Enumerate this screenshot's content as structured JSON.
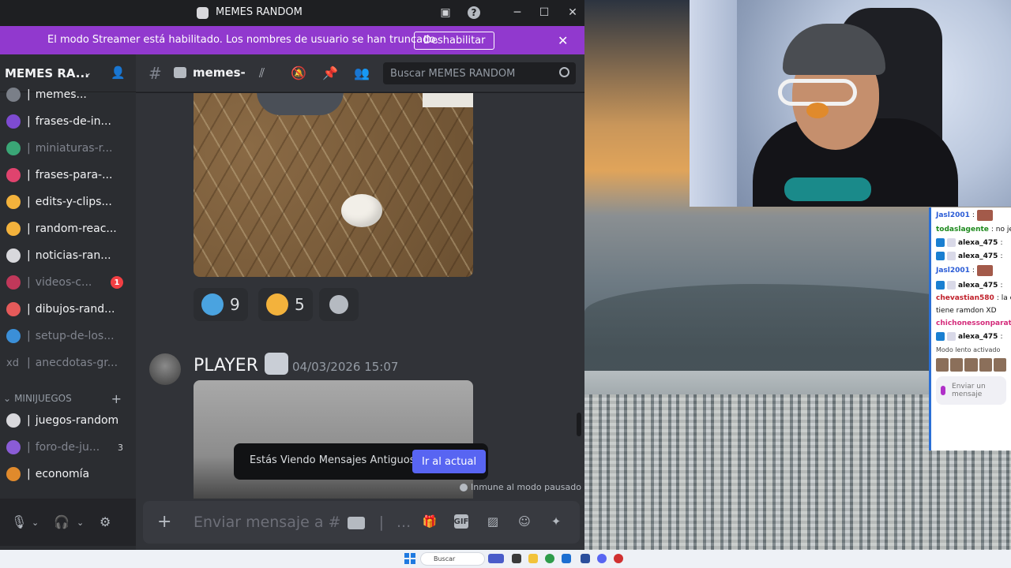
{
  "window": {
    "title": "MEMES RANDOM",
    "help_label": "?",
    "minimize_label": "─",
    "maximize_label": "☐",
    "close_label": "✕"
  },
  "streamer_banner": {
    "text": "El modo Streamer está habilitado. Los nombres de usuario se han truncado.",
    "button_label": "Deshabilitar",
    "close_label": "✕"
  },
  "server": {
    "name": "MEMES RA...",
    "chevron": "⌄"
  },
  "channels": [
    {
      "label": "memes...",
      "emoji_color": "#7a7f88",
      "muted": false,
      "extra": ""
    },
    {
      "label": "frases-de-in...",
      "emoji_color": "#7e4bd1",
      "muted": false,
      "extra": ""
    },
    {
      "label": "miniaturas-r...",
      "emoji_color": "#3aa676",
      "muted": true,
      "extra": ""
    },
    {
      "label": "frases-para-...",
      "emoji_color": "#e0436e",
      "muted": false,
      "extra": ""
    },
    {
      "label": "edits-y-clips...",
      "emoji_color": "#f3b23c",
      "muted": false,
      "extra": ""
    },
    {
      "label": "random-reac...",
      "emoji_color": "#f3b23c",
      "muted": false,
      "extra": ""
    },
    {
      "label": "noticias-ran...",
      "emoji_color": "#d8d8dc",
      "muted": false,
      "extra": ""
    },
    {
      "label": "videos-c...",
      "emoji_color": "#c0385a",
      "muted": true,
      "extra": "1"
    },
    {
      "label": "dibujos-rand...",
      "emoji_color": "#e55a5a",
      "muted": false,
      "extra": ""
    },
    {
      "label": "setup-de-los...",
      "emoji_color": "#3b8fd8",
      "muted": true,
      "extra": ""
    },
    {
      "label": "anecdotas-gr...",
      "emoji_color": "",
      "prefix": "xd",
      "muted": true,
      "extra": ""
    }
  ],
  "category": {
    "label": "MINIJUEGOS",
    "chevron": "⌄",
    "add": "+"
  },
  "channels2": [
    {
      "label": "juegos-random",
      "emoji_color": "#d8d8dc",
      "muted": false,
      "extra": ""
    },
    {
      "label": "foro-de-ju...",
      "emoji_color": "#8a5cd6",
      "muted": true,
      "extra": "3"
    },
    {
      "label": "economía",
      "emoji_color": "#e08a2c",
      "muted": false,
      "extra": ""
    }
  ],
  "user_panel": {
    "mic": "🎙",
    "headset": "🎧",
    "chev": "⌄",
    "settings": "⚙"
  },
  "channel_header": {
    "hash": "#",
    "name": "memes-",
    "search_placeholder": "Buscar MEMES RANDOM"
  },
  "reactions": [
    {
      "count": "9",
      "color": "#4aa3e0"
    },
    {
      "count": "5",
      "color": "#f3b23c"
    }
  ],
  "message": {
    "author": "PLAYER",
    "timestamp": "04/03/2026 15:07"
  },
  "old_messages": {
    "label": "Estás Viendo Mensajes Antiguos",
    "button": "Ir al actual"
  },
  "pause_note": "Inmune al modo pausado",
  "composer": {
    "plus": "+",
    "placeholder": "Enviar mensaje a #",
    "ellipsis": "...",
    "gif": "GIF"
  },
  "stream_chat": {
    "lines": [
      {
        "user": "Jasl2001",
        "color": "#2a5bd6",
        "msg": ":",
        "badges": false,
        "emote": true
      },
      {
        "user": "todaslagente",
        "color": "#1e8a1e",
        "msg": ": no je",
        "badges": false,
        "emote": false
      },
      {
        "user": "alexa_475",
        "color": "#111111",
        "msg": ":",
        "badges": true,
        "emote": false
      },
      {
        "user": "alexa_475",
        "color": "#111111",
        "msg": ":",
        "badges": true,
        "emote": false
      },
      {
        "user": "Jasl2001",
        "color": "#2a5bd6",
        "msg": ":",
        "badges": false,
        "emote": true
      },
      {
        "user": "alexa_475",
        "color": "#111111",
        "msg": ":",
        "badges": true,
        "emote": false
      },
      {
        "user": "chevastian580",
        "color": "#c0202a",
        "msg": ": la c",
        "badges": false,
        "emote": false
      },
      {
        "user": "",
        "color": "#111111",
        "msg": "tiene ramdon XD",
        "badges": false,
        "emote": false
      },
      {
        "user": "chichonessonparat",
        "color": "#d42a7a",
        "msg": "",
        "badges": false,
        "emote": false
      },
      {
        "user": "alexa_475",
        "color": "#111111",
        "msg": ":",
        "badges": true,
        "emote": false
      }
    ],
    "slow_mode": "Modo lento activado",
    "input_placeholder": "Enviar un mensaje"
  },
  "taskbar": {
    "search_label": "Buscar"
  }
}
